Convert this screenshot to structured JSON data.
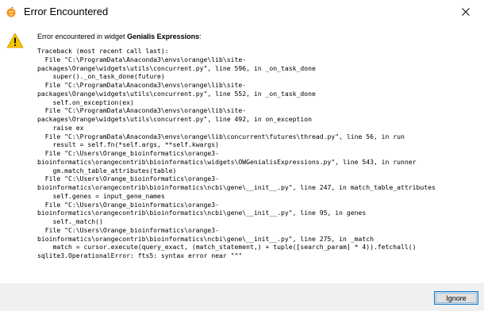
{
  "window": {
    "title": "Error Encountered",
    "app_icon": "orange-app-icon",
    "close_icon": "close-icon",
    "warning_icon": "warning-icon"
  },
  "message": {
    "prefix": "Error encountered in widget ",
    "widget_name": "Genialis Expressions",
    "suffix": ":"
  },
  "traceback": [
    "Traceback (most recent call last):",
    "  File \"C:\\ProgramData\\Anaconda3\\envs\\orange\\lib\\site-",
    "packages\\Orange\\widgets\\utils\\concurrent.py\", line 596, in _on_task_done",
    "    super()._on_task_done(future)",
    "  File \"C:\\ProgramData\\Anaconda3\\envs\\orange\\lib\\site-",
    "packages\\Orange\\widgets\\utils\\concurrent.py\", line 552, in _on_task_done",
    "    self.on_exception(ex)",
    "  File \"C:\\ProgramData\\Anaconda3\\envs\\orange\\lib\\site-",
    "packages\\Orange\\widgets\\utils\\concurrent.py\", line 492, in on_exception",
    "    raise ex",
    "  File \"C:\\ProgramData\\Anaconda3\\envs\\orange\\lib\\concurrent\\futures\\thread.py\", line 56, in run",
    "    result = self.fn(*self.args, **self.kwargs)",
    "  File \"C:\\Users\\Orange_bioinformatics\\orange3-",
    "bioinformatics\\orangecontrib\\bioinformatics\\widgets\\OWGenialisExpressions.py\", line 543, in runner",
    "    gm.match_table_attributes(table)",
    "  File \"C:\\Users\\Orange_bioinformatics\\orange3-",
    "bioinformatics\\orangecontrib\\bioinformatics\\ncbi\\gene\\__init__.py\", line 247, in match_table_attributes",
    "    self.genes = input_gene_names",
    "  File \"C:\\Users\\Orange_bioinformatics\\orange3-",
    "bioinformatics\\orangecontrib\\bioinformatics\\ncbi\\gene\\__init__.py\", line 95, in genes",
    "    self._match()",
    "  File \"C:\\Users\\Orange_bioinformatics\\orange3-",
    "bioinformatics\\orangecontrib\\bioinformatics\\ncbi\\gene\\__init__.py\", line 275, in _match",
    "    match = cursor.execute(query_exact, (match_statement,) + tuple([search_param] * 4)).fetchall()",
    "sqlite3.OperationalError: fts5: syntax error near \"^\""
  ],
  "buttons": {
    "ignore_label": "Ignore"
  },
  "colors": {
    "accent": "#0078d7",
    "warning": "#f8c400",
    "footer": "#f0f0f0"
  }
}
